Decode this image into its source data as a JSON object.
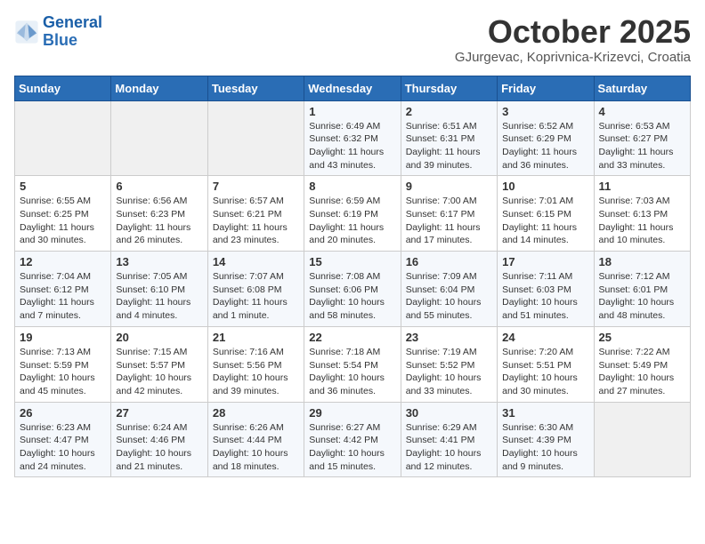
{
  "header": {
    "logo_line1": "General",
    "logo_line2": "Blue",
    "title": "October 2025",
    "subtitle": "GJurgevac, Koprivnica-Krizevci, Croatia"
  },
  "weekdays": [
    "Sunday",
    "Monday",
    "Tuesday",
    "Wednesday",
    "Thursday",
    "Friday",
    "Saturday"
  ],
  "weeks": [
    [
      {
        "day": "",
        "info": ""
      },
      {
        "day": "",
        "info": ""
      },
      {
        "day": "",
        "info": ""
      },
      {
        "day": "1",
        "info": "Sunrise: 6:49 AM\nSunset: 6:32 PM\nDaylight: 11 hours\nand 43 minutes."
      },
      {
        "day": "2",
        "info": "Sunrise: 6:51 AM\nSunset: 6:31 PM\nDaylight: 11 hours\nand 39 minutes."
      },
      {
        "day": "3",
        "info": "Sunrise: 6:52 AM\nSunset: 6:29 PM\nDaylight: 11 hours\nand 36 minutes."
      },
      {
        "day": "4",
        "info": "Sunrise: 6:53 AM\nSunset: 6:27 PM\nDaylight: 11 hours\nand 33 minutes."
      }
    ],
    [
      {
        "day": "5",
        "info": "Sunrise: 6:55 AM\nSunset: 6:25 PM\nDaylight: 11 hours\nand 30 minutes."
      },
      {
        "day": "6",
        "info": "Sunrise: 6:56 AM\nSunset: 6:23 PM\nDaylight: 11 hours\nand 26 minutes."
      },
      {
        "day": "7",
        "info": "Sunrise: 6:57 AM\nSunset: 6:21 PM\nDaylight: 11 hours\nand 23 minutes."
      },
      {
        "day": "8",
        "info": "Sunrise: 6:59 AM\nSunset: 6:19 PM\nDaylight: 11 hours\nand 20 minutes."
      },
      {
        "day": "9",
        "info": "Sunrise: 7:00 AM\nSunset: 6:17 PM\nDaylight: 11 hours\nand 17 minutes."
      },
      {
        "day": "10",
        "info": "Sunrise: 7:01 AM\nSunset: 6:15 PM\nDaylight: 11 hours\nand 14 minutes."
      },
      {
        "day": "11",
        "info": "Sunrise: 7:03 AM\nSunset: 6:13 PM\nDaylight: 11 hours\nand 10 minutes."
      }
    ],
    [
      {
        "day": "12",
        "info": "Sunrise: 7:04 AM\nSunset: 6:12 PM\nDaylight: 11 hours\nand 7 minutes."
      },
      {
        "day": "13",
        "info": "Sunrise: 7:05 AM\nSunset: 6:10 PM\nDaylight: 11 hours\nand 4 minutes."
      },
      {
        "day": "14",
        "info": "Sunrise: 7:07 AM\nSunset: 6:08 PM\nDaylight: 11 hours\nand 1 minute."
      },
      {
        "day": "15",
        "info": "Sunrise: 7:08 AM\nSunset: 6:06 PM\nDaylight: 10 hours\nand 58 minutes."
      },
      {
        "day": "16",
        "info": "Sunrise: 7:09 AM\nSunset: 6:04 PM\nDaylight: 10 hours\nand 55 minutes."
      },
      {
        "day": "17",
        "info": "Sunrise: 7:11 AM\nSunset: 6:03 PM\nDaylight: 10 hours\nand 51 minutes."
      },
      {
        "day": "18",
        "info": "Sunrise: 7:12 AM\nSunset: 6:01 PM\nDaylight: 10 hours\nand 48 minutes."
      }
    ],
    [
      {
        "day": "19",
        "info": "Sunrise: 7:13 AM\nSunset: 5:59 PM\nDaylight: 10 hours\nand 45 minutes."
      },
      {
        "day": "20",
        "info": "Sunrise: 7:15 AM\nSunset: 5:57 PM\nDaylight: 10 hours\nand 42 minutes."
      },
      {
        "day": "21",
        "info": "Sunrise: 7:16 AM\nSunset: 5:56 PM\nDaylight: 10 hours\nand 39 minutes."
      },
      {
        "day": "22",
        "info": "Sunrise: 7:18 AM\nSunset: 5:54 PM\nDaylight: 10 hours\nand 36 minutes."
      },
      {
        "day": "23",
        "info": "Sunrise: 7:19 AM\nSunset: 5:52 PM\nDaylight: 10 hours\nand 33 minutes."
      },
      {
        "day": "24",
        "info": "Sunrise: 7:20 AM\nSunset: 5:51 PM\nDaylight: 10 hours\nand 30 minutes."
      },
      {
        "day": "25",
        "info": "Sunrise: 7:22 AM\nSunset: 5:49 PM\nDaylight: 10 hours\nand 27 minutes."
      }
    ],
    [
      {
        "day": "26",
        "info": "Sunrise: 6:23 AM\nSunset: 4:47 PM\nDaylight: 10 hours\nand 24 minutes."
      },
      {
        "day": "27",
        "info": "Sunrise: 6:24 AM\nSunset: 4:46 PM\nDaylight: 10 hours\nand 21 minutes."
      },
      {
        "day": "28",
        "info": "Sunrise: 6:26 AM\nSunset: 4:44 PM\nDaylight: 10 hours\nand 18 minutes."
      },
      {
        "day": "29",
        "info": "Sunrise: 6:27 AM\nSunset: 4:42 PM\nDaylight: 10 hours\nand 15 minutes."
      },
      {
        "day": "30",
        "info": "Sunrise: 6:29 AM\nSunset: 4:41 PM\nDaylight: 10 hours\nand 12 minutes."
      },
      {
        "day": "31",
        "info": "Sunrise: 6:30 AM\nSunset: 4:39 PM\nDaylight: 10 hours\nand 9 minutes."
      },
      {
        "day": "",
        "info": ""
      }
    ]
  ]
}
